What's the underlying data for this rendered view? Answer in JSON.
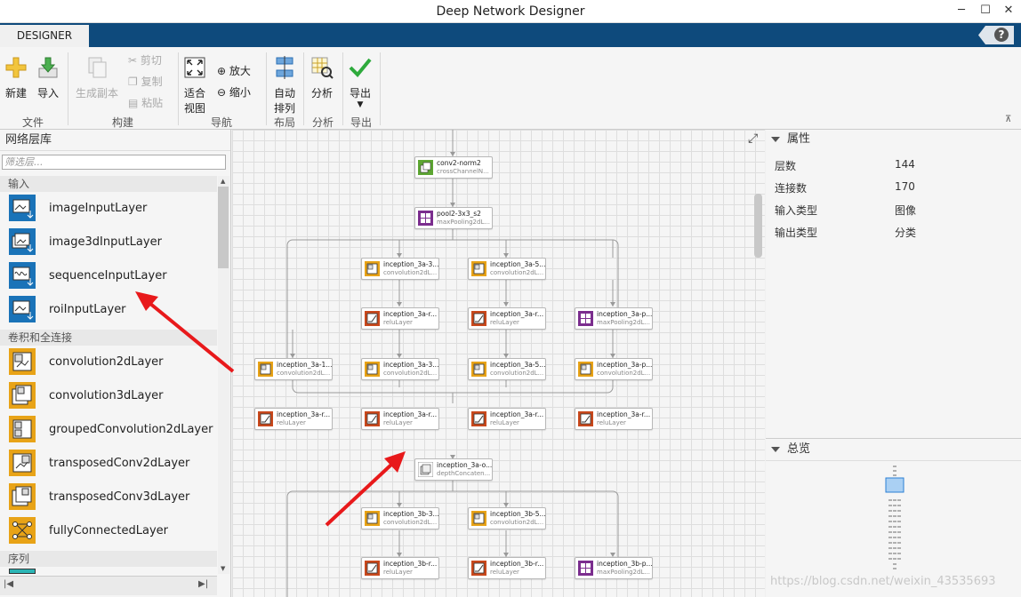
{
  "window": {
    "title": "Deep Network Designer",
    "min": "─",
    "max": "☐",
    "close": "✕"
  },
  "tab": {
    "label": "DESIGNER",
    "help": "?"
  },
  "ribbon": {
    "new": "新建",
    "import": "导入",
    "duplicate": "生成副本",
    "cut": "剪切",
    "copy": "复制",
    "paste": "粘贴",
    "fit_line1": "适合",
    "fit_line2": "视图",
    "zoom_in": "放大",
    "zoom_out": "缩小",
    "auto_line1": "自动",
    "auto_line2": "排列",
    "analyze": "分析",
    "export": "导出",
    "groups": {
      "file": "文件",
      "build": "构建",
      "navigate": "导航",
      "layout": "布局",
      "analyze": "分析",
      "export": "导出"
    }
  },
  "library": {
    "title": "网络层库",
    "filter_placeholder": "筛选层...",
    "categories": [
      "输入",
      "卷积和全连接",
      "序列"
    ],
    "items": [
      "imageInputLayer",
      "image3dInputLayer",
      "sequenceInputLayer",
      "roiInputLayer",
      "convolution2dLayer",
      "convolution3dLayer",
      "groupedConvolution2dLayer",
      "transposedConv2dLayer",
      "transposedConv3dLayer",
      "fullyConnectedLayer"
    ]
  },
  "graph": {
    "nodes": [
      {
        "name": "conv2-norm2",
        "type": "crossChannelN...",
        "kind": "norm"
      },
      {
        "name": "pool2-3x3_s2",
        "type": "maxPooling2dL...",
        "kind": "pool"
      },
      {
        "name": "inception_3a-3...",
        "type": "convolution2dL...",
        "kind": "conv"
      },
      {
        "name": "inception_3a-5...",
        "type": "convolution2dL...",
        "kind": "conv"
      },
      {
        "name": "inception_3a-r...",
        "type": "reluLayer",
        "kind": "relu"
      },
      {
        "name": "inception_3a-r...",
        "type": "reluLayer",
        "kind": "relu"
      },
      {
        "name": "inception_3a-p...",
        "type": "maxPooling2dL...",
        "kind": "pool"
      },
      {
        "name": "inception_3a-1...",
        "type": "convolution2dL...",
        "kind": "conv"
      },
      {
        "name": "inception_3a-3...",
        "type": "convolution2dL...",
        "kind": "conv"
      },
      {
        "name": "inception_3a-5...",
        "type": "convolution2dL...",
        "kind": "conv"
      },
      {
        "name": "inception_3a-p...",
        "type": "convolution2dL...",
        "kind": "conv"
      },
      {
        "name": "inception_3a-r...",
        "type": "reluLayer",
        "kind": "relu"
      },
      {
        "name": "inception_3a-r...",
        "type": "reluLayer",
        "kind": "relu"
      },
      {
        "name": "inception_3a-r...",
        "type": "reluLayer",
        "kind": "relu"
      },
      {
        "name": "inception_3a-r...",
        "type": "reluLayer",
        "kind": "relu"
      },
      {
        "name": "inception_3a-o...",
        "type": "depthConcaten...",
        "kind": "concat"
      },
      {
        "name": "inception_3b-3...",
        "type": "convolution2dL...",
        "kind": "conv"
      },
      {
        "name": "inception_3b-5...",
        "type": "convolution2dL...",
        "kind": "conv"
      },
      {
        "name": "inception_3b-r...",
        "type": "reluLayer",
        "kind": "relu"
      },
      {
        "name": "inception_3b-r...",
        "type": "reluLayer",
        "kind": "relu"
      },
      {
        "name": "inception_3b-p...",
        "type": "maxPooling2dL...",
        "kind": "pool"
      }
    ]
  },
  "properties": {
    "title": "属性",
    "rows": [
      {
        "label": "层数",
        "value": "144"
      },
      {
        "label": "连接数",
        "value": "170"
      },
      {
        "label": "输入类型",
        "value": "图像"
      },
      {
        "label": "输出类型",
        "value": "分类"
      }
    ]
  },
  "overview": {
    "title": "总览"
  },
  "watermark": "https://blog.csdn.net/weixin_43535693",
  "colors": {
    "accent": "#0e4a7c",
    "conv": "#e8a317",
    "relu": "#c9481c",
    "pool": "#7b2d8e",
    "norm": "#5da632",
    "input": "#1a73b8",
    "arrow": "#e8191b"
  }
}
